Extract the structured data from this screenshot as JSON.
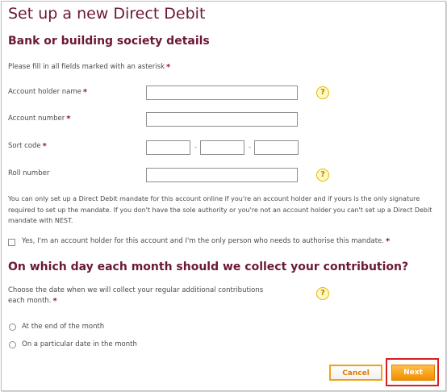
{
  "page": {
    "title": "Set up a new Direct Debit"
  },
  "bank_section": {
    "heading": "Bank or building society details",
    "instruction": "Please fill in all fields marked with an asterisk",
    "asterisk": "*",
    "fields": {
      "account_holder_name": {
        "label": "Account holder name",
        "value": "",
        "required": true
      },
      "account_number": {
        "label": "Account number",
        "value": "",
        "required": true
      },
      "sort_code": {
        "label": "Sort code",
        "part1": "",
        "part2": "",
        "part3": "",
        "separator": "-",
        "required": true
      },
      "roll_number": {
        "label": "Roll number",
        "value": "",
        "required": false
      }
    },
    "help_icon": "?",
    "info_text": "You can only set up a Direct Debit mandate for this account online if you're an account holder and if yours is the only signature required to set up the mandate. If you don't have the sole authority or you're not an account holder you can't set up a Direct Debit mandate with NEST.",
    "confirm_label": "Yes, I'm an account holder for this account and I'm the only person who needs to authorise this mandate."
  },
  "collection_section": {
    "heading": "On which day each month should we collect your contribution?",
    "instruction": "Choose the date when we will collect your regular additional contributions each month.",
    "options": [
      {
        "label": "At the end of the month",
        "checked": false
      },
      {
        "label": "On a particular date in the month",
        "checked": false
      }
    ]
  },
  "buttons": {
    "cancel": "Cancel",
    "next": "Next"
  },
  "colors": {
    "heading": "#6b1838",
    "button_orange": "#f28e00",
    "highlight_red": "#d81e1e"
  }
}
